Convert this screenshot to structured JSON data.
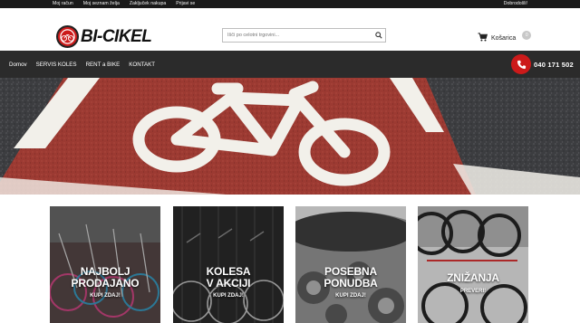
{
  "topbar": {
    "links": [
      "Moj račun",
      "Moj seznam želja",
      "Zaključek nakupa",
      "Prijavi se"
    ],
    "welcome": "Dobrodošli!"
  },
  "header": {
    "logo_text": "BI-CIKEL",
    "search_placeholder": "Išči po celotni trgovini...",
    "cart_label": "Košarica",
    "cart_count": "0"
  },
  "nav": {
    "items": [
      "Domov",
      "SERVIS KOLES",
      "RENT a BIKE",
      "KONTAKT"
    ],
    "phone": "040 171 502"
  },
  "tiles": [
    {
      "title_line1": "NAJBOLJ",
      "title_line2": "PRODAJANO",
      "subtitle": "KUPI ZDAJ!"
    },
    {
      "title_line1": "KOLESA",
      "title_line2": "V AKCIJI",
      "subtitle": "KUPI ZDAJ!"
    },
    {
      "title_line1": "POSEBNA",
      "title_line2": "PONUDBA",
      "subtitle": "KUPI ZDAJ!"
    },
    {
      "title_line1": "ZNIŽANJA",
      "title_line2": "",
      "subtitle": "PREVERI!"
    }
  ],
  "colors": {
    "brand_red": "#cc1a1a",
    "topbar": "#1a1a1a",
    "nav": "#2b2b2b",
    "bike_lane": "#9c3a32"
  },
  "icons": {
    "logo": "bicycle-wheel-logo-icon",
    "search": "search-icon",
    "cart": "shopping-cart-icon",
    "phone": "phone-icon"
  }
}
